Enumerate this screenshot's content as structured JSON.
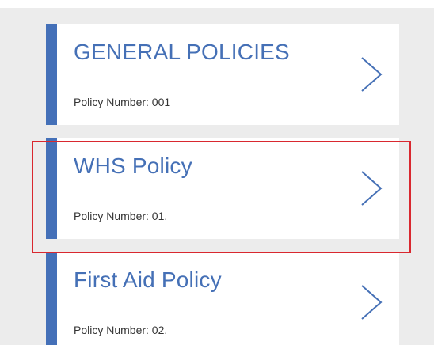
{
  "policies": [
    {
      "title": "GENERAL POLICIES",
      "subtitle": "Policy Number: 001"
    },
    {
      "title": "WHS Policy",
      "subtitle": "Policy Number: 01."
    },
    {
      "title": "First Aid Policy",
      "subtitle": "Policy Number: 02."
    }
  ],
  "colors": {
    "accent_bar": "#4470b8",
    "title_text": "#4570b6",
    "highlight_border": "#d9282f",
    "background": "#ececec"
  },
  "icons": {
    "chevron": "chevron-right-icon"
  }
}
